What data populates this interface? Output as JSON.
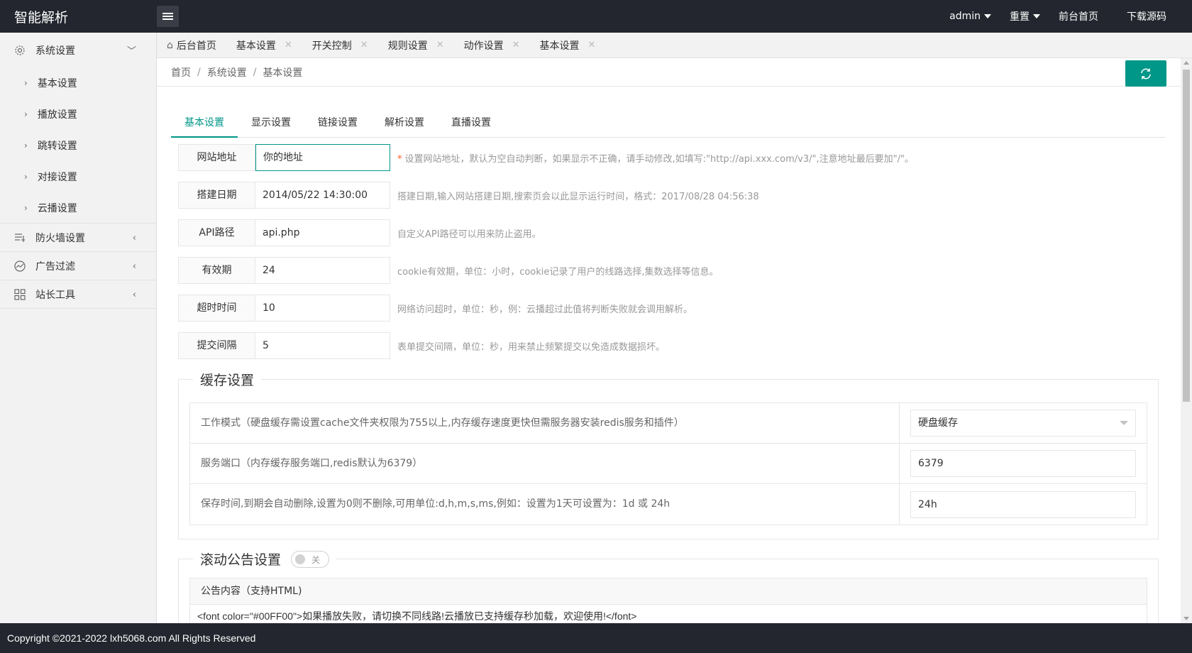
{
  "app": {
    "title": "智能解析"
  },
  "header": {
    "user": "admin",
    "reset": "重置",
    "front_home": "前台首页",
    "download": "下载源码"
  },
  "sidebar": {
    "groups": [
      {
        "label": "系统设置",
        "icon": "gear-icon",
        "expanded": true,
        "items": [
          "基本设置",
          "播放设置",
          "跳转设置",
          "对接设置",
          "云播设置"
        ]
      },
      {
        "label": "防火墙设置",
        "icon": "list-icon"
      },
      {
        "label": "广告过滤",
        "icon": "chart-icon"
      },
      {
        "label": "站长工具",
        "icon": "grid-icon"
      }
    ]
  },
  "tabs": [
    "后台首页",
    "基本设置",
    "开关控制",
    "规则设置",
    "动作设置",
    "基本设置"
  ],
  "breadcrumb": [
    "首页",
    "系统设置",
    "基本设置"
  ],
  "subtabs": [
    "基本设置",
    "显示设置",
    "链接设置",
    "解析设置",
    "直播设置"
  ],
  "form": {
    "rows": [
      {
        "label": "网站地址",
        "value": "你的地址",
        "required": true,
        "tip": "设置网站地址，默认为空自动判断，如果显示不正确，请手动修改,如填写:\"http://api.xxx.com/v3/\",注意地址最后要加\"/\"。"
      },
      {
        "label": "搭建日期",
        "value": "2014/05/22 14:30:00",
        "tip": "搭建日期,输入网站搭建日期,搜索页会以此显示运行时间，格式：2017/08/28 04:56:38"
      },
      {
        "label": "API路径",
        "value": "api.php",
        "tip": "自定义API路径可以用来防止盗用。"
      },
      {
        "label": "有效期",
        "value": "24",
        "tip": "cookie有效期，单位：小时，cookie记录了用户的线路选择,集数选择等信息。"
      },
      {
        "label": "超时时间",
        "value": "10",
        "tip": "网络访问超时，单位：秒，例：云播超过此值将判断失败就会调用解析。"
      },
      {
        "label": "提交间隔",
        "value": "5",
        "tip": "表单提交间隔，单位：秒，用来禁止频繁提交以免造成数据损坏。"
      }
    ]
  },
  "cache": {
    "title": "缓存设置",
    "rows": [
      {
        "label": "工作模式（硬盘缓存需设置cache文件夹权限为755以上,内存缓存速度更快但需服务器安装redis服务和插件）",
        "value": "硬盘缓存"
      },
      {
        "label": "服务端口（内存缓存服务端口,redis默认为6379）",
        "value": "6379"
      },
      {
        "label": "保存时间,到期会自动删除,设置为0则不删除,可用单位:d,h,m,s,ms,例如：设置为1天可设置为：1d 或 24h",
        "value": "24h"
      }
    ]
  },
  "notice": {
    "title": "滚动公告设置",
    "switch_label": "关",
    "head": "公告内容（支持HTML)",
    "content": "<font color=\"#00FF00\">如果播放失败，请切换不同线路!云播放已支持缓存秒加载，欢迎使用!</font>"
  },
  "footer": {
    "text": "Copyright ©2021-2022 lxh5068.com All Rights Reserved"
  },
  "colors": {
    "accent": "#009688",
    "topbar": "#23262e",
    "required": "#ff5722"
  }
}
